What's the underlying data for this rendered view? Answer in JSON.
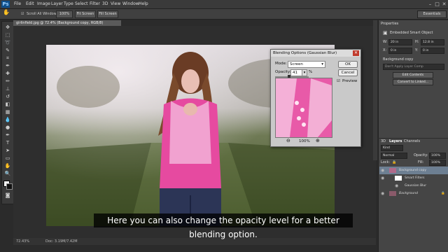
{
  "app": {
    "logo": "Ps"
  },
  "menubar": {
    "items": [
      "File",
      "Edit",
      "Image",
      "Layer",
      "Type",
      "Select",
      "Filter",
      "3D",
      "View",
      "Window",
      "Help"
    ]
  },
  "optionsbar": {
    "scroll_all": "Scroll All Windows",
    "zoom_100": "100%",
    "fit_screen": "Fit Screen",
    "fill_screen": "Fill Screen",
    "workspace": "Essentials"
  },
  "document": {
    "tab": "girlinfield.jpg @ 72.4% (Background copy, RGB/8) ",
    "zoom": "72.43%",
    "doc_info": "Doc: 3.19M/7.42M"
  },
  "properties": {
    "title": "Properties",
    "smart_object": "Embedded Smart Object",
    "w_label": "W:",
    "w_value": "20 in",
    "h_label": "H:",
    "h_value": "12.8 in",
    "x_label": "X:",
    "x_value": "0 in",
    "y_label": "Y:",
    "y_value": "0 in",
    "layer_name": "Background copy",
    "layer_comp": "Don't Apply Layer Comp",
    "edit_contents": "Edit Contents",
    "convert": "Convert to Linked..."
  },
  "layers": {
    "tabs": [
      "3D",
      "Layers",
      "Channels"
    ],
    "kind": "Kind",
    "blend": "Normal",
    "opacity_label": "Opacity:",
    "opacity": "100%",
    "lock_label": "Lock:",
    "fill_label": "Fill:",
    "fill": "100%",
    "rows": [
      "Background copy",
      "Smart Filters",
      "Gaussian Blur",
      "Background"
    ]
  },
  "dialog": {
    "title": "Blending Options (Gaussian Blur)",
    "mode_label": "Mode:",
    "mode_value": "Screen",
    "opacity_label": "Opacity:",
    "opacity_value": "41",
    "opacity_unit": "%",
    "opacity_fraction": 0.41,
    "ok": "OK",
    "cancel": "Cancel",
    "preview_label": "Preview",
    "zoom": "100%"
  },
  "caption": "Here you can also change the opacity level for a better blending option.",
  "colors": {
    "accent": "#e0e0e0",
    "pink": "#e64aa0",
    "panel": "#454545",
    "selected_layer": "#6d7f92"
  },
  "icons": [
    "ps-logo",
    "minimize-icon",
    "maximize-icon",
    "close-icon",
    "hand-icon",
    "zoom-in-icon",
    "zoom-out-icon",
    "eye-icon",
    "lock-icon",
    "dropdown-arrow-icon",
    "checkbox-checked-icon"
  ]
}
